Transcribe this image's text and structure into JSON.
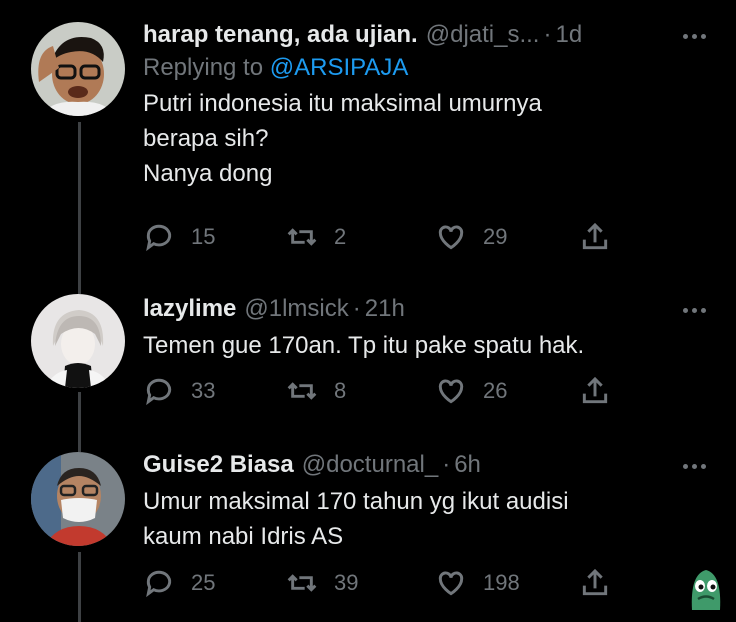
{
  "tweets": [
    {
      "name": "harap tenang, ada ujian.",
      "handle": "@djati_s...",
      "time": "1d",
      "reply_prefix": "Replying to",
      "reply_to": "@ARSIPAJA",
      "text": "Putri indonesia itu maksimal umurnya\nberapa sih?\nNanya dong",
      "replies": "15",
      "retweets": "2",
      "likes": "29"
    },
    {
      "name": "lazylime",
      "handle": "@1lmsick",
      "time": "21h",
      "text": "Temen gue 170an. Tp itu pake spatu hak.",
      "replies": "33",
      "retweets": "8",
      "likes": "26"
    },
    {
      "name": "Guise2 Biasa",
      "handle": "@docturnal_",
      "time": "6h",
      "text": "Umur maksimal 170 tahun yg ikut audisi\nkaum nabi Idris AS",
      "replies": "25",
      "retweets": "39",
      "likes": "198"
    }
  ],
  "icons": [
    "reply-icon",
    "retweet-icon",
    "like-icon",
    "share-icon",
    "more-icon"
  ],
  "colors": {
    "background": "#000000",
    "text": "#e7e9ea",
    "muted": "#71767b",
    "link": "#1d9bf0",
    "thread_line": "#3e4144"
  }
}
